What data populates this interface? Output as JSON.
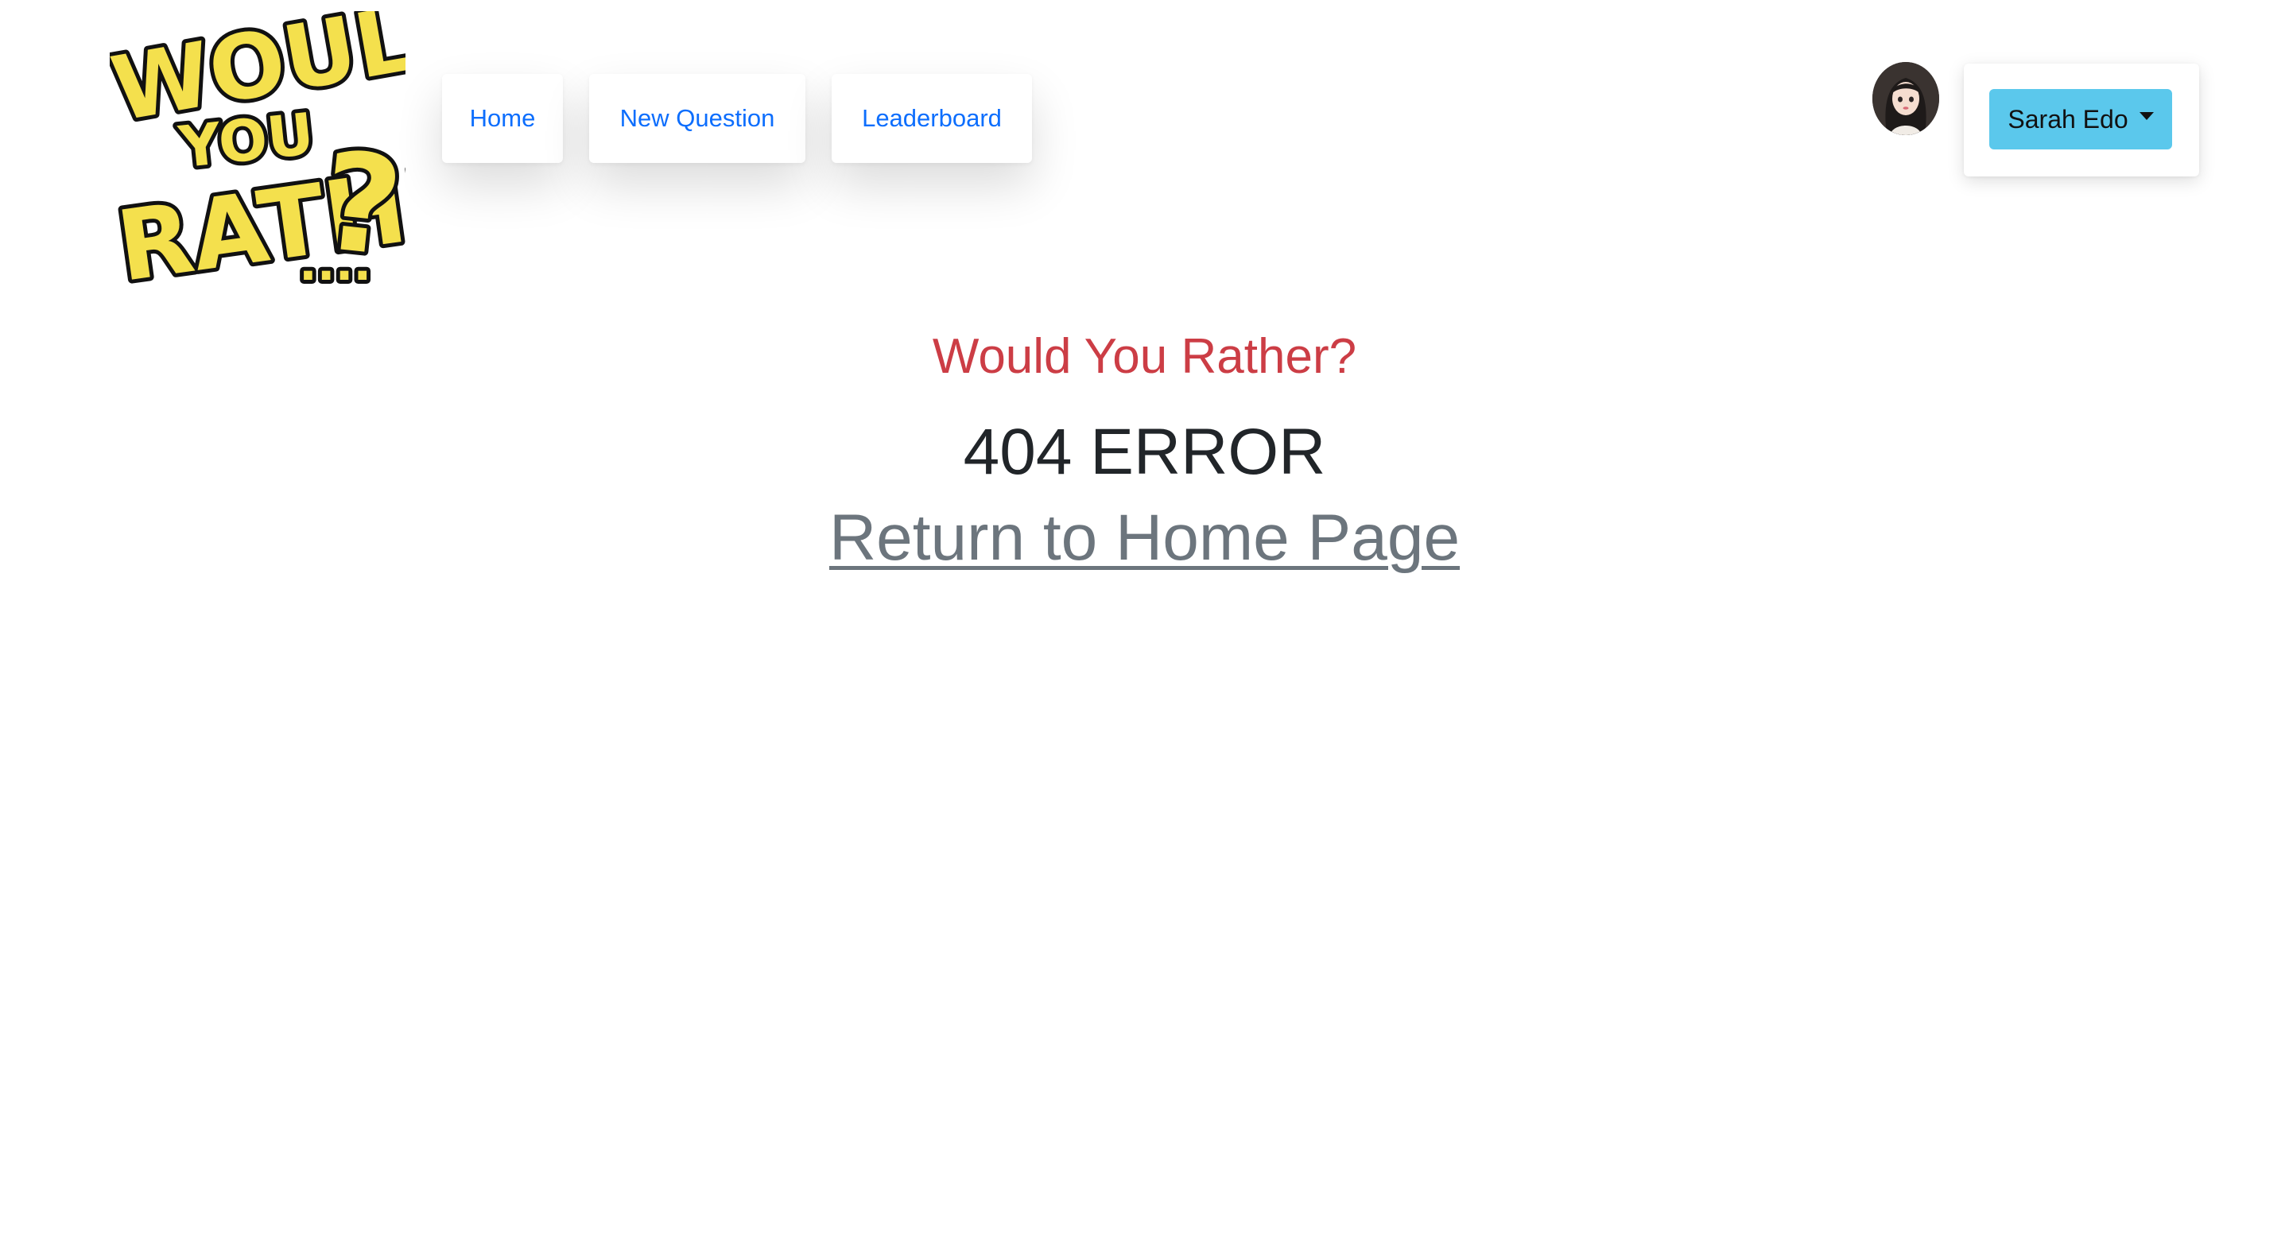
{
  "logo": {
    "alt": "Would You Rather?..."
  },
  "nav": {
    "items": [
      {
        "label": "Home"
      },
      {
        "label": "New Question"
      },
      {
        "label": "Leaderboard"
      }
    ]
  },
  "user": {
    "name": "Sarah Edo",
    "avatar_icon": "avatar-woman-icon",
    "menu_icon": "caret-down-icon"
  },
  "main": {
    "title": "Would You Rather?",
    "error": "404 ERROR",
    "link_label": "Return to Home Page"
  },
  "colors": {
    "nav_link": "#0d6efd",
    "title": "#cc3d45",
    "user_button": "#5bc8ec",
    "link": "#6c757d"
  }
}
